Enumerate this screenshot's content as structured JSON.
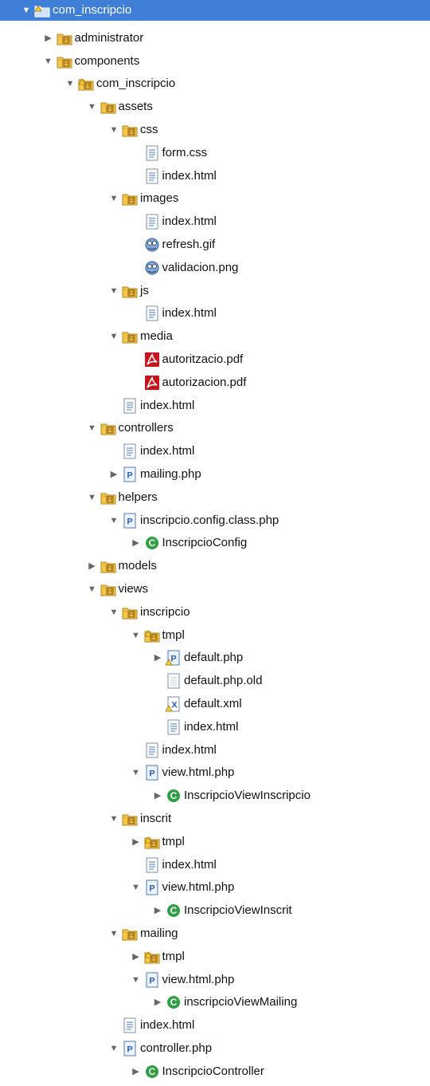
{
  "project_tree": {
    "rows": [
      {
        "label": "com_inscripcio",
        "depth": 0,
        "twisty": "open",
        "icon": "project-folder-icon",
        "selected": true
      },
      {
        "label": "administrator",
        "depth": 1,
        "twisty": "closed",
        "icon": "package-folder-icon"
      },
      {
        "label": "components",
        "depth": 1,
        "twisty": "open",
        "icon": "package-folder-icon"
      },
      {
        "label": "com_inscripcio",
        "depth": 2,
        "twisty": "open",
        "icon": "package-folder-warning-icon"
      },
      {
        "label": "assets",
        "depth": 3,
        "twisty": "open",
        "icon": "package-folder-icon"
      },
      {
        "label": "css",
        "depth": 4,
        "twisty": "open",
        "icon": "package-folder-icon"
      },
      {
        "label": "form.css",
        "depth": 5,
        "twisty": "none",
        "icon": "text-file-icon"
      },
      {
        "label": "index.html",
        "depth": 5,
        "twisty": "none",
        "icon": "text-file-icon"
      },
      {
        "label": "images",
        "depth": 4,
        "twisty": "open",
        "icon": "package-folder-icon"
      },
      {
        "label": "index.html",
        "depth": 5,
        "twisty": "none",
        "icon": "text-file-icon"
      },
      {
        "label": "refresh.gif",
        "depth": 5,
        "twisty": "none",
        "icon": "image-file-icon"
      },
      {
        "label": "validacion.png",
        "depth": 5,
        "twisty": "none",
        "icon": "image-file-icon"
      },
      {
        "label": "js",
        "depth": 4,
        "twisty": "open",
        "icon": "package-folder-icon"
      },
      {
        "label": "index.html",
        "depth": 5,
        "twisty": "none",
        "icon": "text-file-icon"
      },
      {
        "label": "media",
        "depth": 4,
        "twisty": "open",
        "icon": "package-folder-icon"
      },
      {
        "label": "autoritzacio.pdf",
        "depth": 5,
        "twisty": "none",
        "icon": "pdf-file-icon"
      },
      {
        "label": "autorizacion.pdf",
        "depth": 5,
        "twisty": "none",
        "icon": "pdf-file-icon"
      },
      {
        "label": "index.html",
        "depth": 4,
        "twisty": "none",
        "icon": "text-file-icon"
      },
      {
        "label": "controllers",
        "depth": 3,
        "twisty": "open",
        "icon": "package-folder-icon"
      },
      {
        "label": "index.html",
        "depth": 4,
        "twisty": "none",
        "icon": "text-file-icon"
      },
      {
        "label": "mailing.php",
        "depth": 4,
        "twisty": "closed",
        "icon": "php-file-icon"
      },
      {
        "label": "helpers",
        "depth": 3,
        "twisty": "open",
        "icon": "package-folder-icon"
      },
      {
        "label": "inscripcio.config.class.php",
        "depth": 4,
        "twisty": "open",
        "icon": "php-file-icon"
      },
      {
        "label": "InscripcioConfig",
        "depth": 5,
        "twisty": "closed",
        "icon": "class-icon"
      },
      {
        "label": "models",
        "depth": 3,
        "twisty": "closed",
        "icon": "package-folder-icon"
      },
      {
        "label": "views",
        "depth": 3,
        "twisty": "open",
        "icon": "package-folder-icon"
      },
      {
        "label": "inscripcio",
        "depth": 4,
        "twisty": "open",
        "icon": "package-folder-icon"
      },
      {
        "label": "tmpl",
        "depth": 5,
        "twisty": "open",
        "icon": "package-folder-warning-icon"
      },
      {
        "label": "default.php",
        "depth": 6,
        "twisty": "closed",
        "icon": "php-file-warning-icon"
      },
      {
        "label": "default.php.old",
        "depth": 6,
        "twisty": "none",
        "icon": "plain-file-icon"
      },
      {
        "label": "default.xml",
        "depth": 6,
        "twisty": "none",
        "icon": "xml-file-warning-icon"
      },
      {
        "label": "index.html",
        "depth": 6,
        "twisty": "none",
        "icon": "text-file-icon"
      },
      {
        "label": "index.html",
        "depth": 5,
        "twisty": "none",
        "icon": "text-file-icon"
      },
      {
        "label": "view.html.php",
        "depth": 5,
        "twisty": "open",
        "icon": "php-file-icon"
      },
      {
        "label": "InscripcioViewInscripcio",
        "depth": 6,
        "twisty": "closed",
        "icon": "class-icon"
      },
      {
        "label": "inscrit",
        "depth": 4,
        "twisty": "open",
        "icon": "package-folder-icon"
      },
      {
        "label": "tmpl",
        "depth": 5,
        "twisty": "closed",
        "icon": "package-folder-warning-icon"
      },
      {
        "label": "index.html",
        "depth": 5,
        "twisty": "none",
        "icon": "text-file-icon"
      },
      {
        "label": "view.html.php",
        "depth": 5,
        "twisty": "open",
        "icon": "php-file-icon"
      },
      {
        "label": "InscripcioViewInscrit",
        "depth": 6,
        "twisty": "closed",
        "icon": "class-icon"
      },
      {
        "label": "mailing",
        "depth": 4,
        "twisty": "open",
        "icon": "package-folder-icon"
      },
      {
        "label": "tmpl",
        "depth": 5,
        "twisty": "closed",
        "icon": "package-folder-warning-icon"
      },
      {
        "label": "view.html.php",
        "depth": 5,
        "twisty": "open",
        "icon": "php-file-icon"
      },
      {
        "label": "inscripcioViewMailing",
        "depth": 6,
        "twisty": "closed",
        "icon": "class-icon"
      },
      {
        "label": "index.html",
        "depth": 4,
        "twisty": "none",
        "icon": "text-file-icon"
      },
      {
        "label": "controller.php",
        "depth": 4,
        "twisty": "open",
        "icon": "php-file-icon"
      },
      {
        "label": "InscripcioController",
        "depth": 5,
        "twisty": "closed",
        "icon": "class-icon"
      }
    ]
  },
  "colors": {
    "selection": "#3f7fd8",
    "folder": "#f3c74a",
    "pdf": "#c4161c",
    "class": "#2ea043",
    "php": "#4a78c2"
  }
}
